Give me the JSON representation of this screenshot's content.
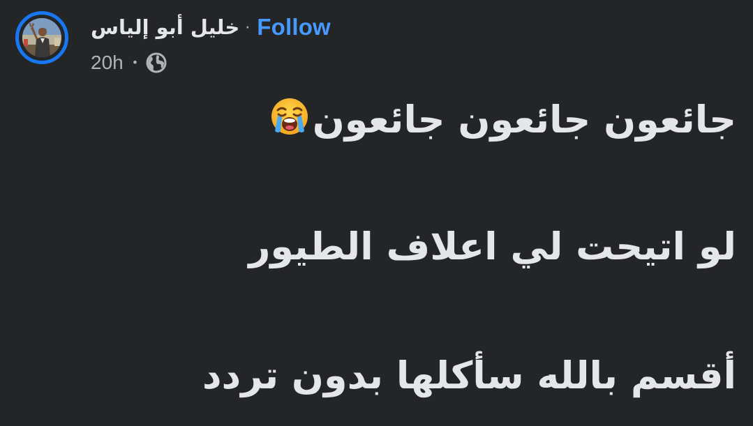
{
  "post": {
    "author": {
      "name": "خليل أبو إلياس",
      "avatar_icon": "profile-photo"
    },
    "separator": "·",
    "follow_label": "Follow",
    "timestamp": "20h",
    "meta_separator": "•",
    "privacy_icon": "globe-icon",
    "lines": [
      "جائعون جائعون جائعون",
      "لو اتيحت لي اعلاف الطيور",
      "أقسم بالله سأكلها بدون تردد"
    ],
    "emoji": "loudly-crying-face-emoji"
  },
  "colors": {
    "background": "#242526",
    "text_primary": "#e4e6eb",
    "text_secondary": "#b0b3b8",
    "link": "#4599ff",
    "avatar_ring": "#1877f2"
  }
}
